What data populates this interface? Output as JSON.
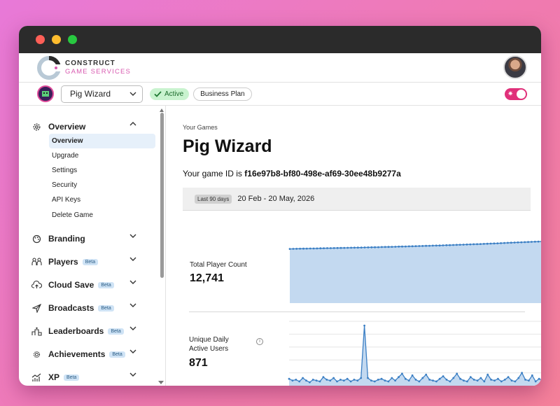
{
  "brand": {
    "name": "CONSTRUCT",
    "subtitle": "GAME SERVICES"
  },
  "toolbar": {
    "game_name": "Pig Wizard",
    "status": "Active",
    "plan": "Business Plan"
  },
  "sidebar": {
    "sections": [
      {
        "label": "Overview",
        "icon": "gear-icon",
        "beta": false,
        "expanded": true
      },
      {
        "label": "Branding",
        "icon": "palette-icon",
        "beta": false
      },
      {
        "label": "Players",
        "icon": "players-icon",
        "beta": true
      },
      {
        "label": "Cloud Save",
        "icon": "cloud-upload-icon",
        "beta": true
      },
      {
        "label": "Broadcasts",
        "icon": "send-icon",
        "beta": true
      },
      {
        "label": "Leaderboards",
        "icon": "podium-icon",
        "beta": true
      },
      {
        "label": "Achievements",
        "icon": "medal-icon",
        "beta": true
      },
      {
        "label": "XP",
        "icon": "chart-up-icon",
        "beta": true
      }
    ],
    "beta_label": "Beta",
    "overview_items": [
      "Overview",
      "Upgrade",
      "Settings",
      "Security",
      "API Keys",
      "Delete Game"
    ],
    "active_item": "Overview"
  },
  "main": {
    "breadcrumb": "Your Games",
    "title": "Pig Wizard",
    "game_id_prefix": "Your game ID is",
    "game_id": "f16e97b8-bf80-498e-af69-30ee48b9277a",
    "range_chip": "Last 90 days",
    "range_text": "20 Feb - 20 May, 2026",
    "stats": {
      "total_label": "Total Player Count",
      "total_value": "12,741",
      "dau_label_1": "Unique Daily",
      "dau_label_2": "Active Users",
      "dau_value": "871"
    }
  },
  "colors": {
    "accent": "#e0307a",
    "chart_line": "#3b7fc4",
    "chart_fill": "#c3d9f0",
    "active_badge_bg": "#c9f3cf"
  },
  "chart_data": [
    {
      "type": "area",
      "series": [
        {
          "values": [
            11200,
            11215,
            11230,
            11250,
            11260,
            11275,
            11290,
            11300,
            11310,
            11330,
            11345,
            11360,
            11370,
            11385,
            11400,
            11410,
            11425,
            11440,
            11455,
            11465,
            11480,
            11500,
            11515,
            11530,
            11545,
            11560,
            11575,
            11590,
            11605,
            11620,
            11640,
            11660,
            11680,
            11700,
            11720,
            11740,
            11760,
            11780,
            11800,
            11820,
            11840,
            11860,
            11880,
            11900,
            11920,
            11945,
            11970,
            11995,
            12020,
            12045,
            12070,
            12095,
            12120,
            12145,
            12170,
            12195,
            12220,
            12250,
            12280,
            12310,
            12340,
            12370,
            12400,
            12430,
            12460,
            12490,
            12520,
            12550,
            12580,
            12610,
            12640,
            12670,
            12700,
            12720,
            12741
          ]
        }
      ],
      "ylim": [
        0,
        12741
      ]
    },
    {
      "type": "area",
      "series": [
        {
          "values": [
            8,
            6,
            7,
            5,
            9,
            6,
            4,
            7,
            6,
            5,
            10,
            7,
            6,
            9,
            5,
            7,
            6,
            8,
            5,
            7,
            6,
            9,
            70,
            9,
            6,
            5,
            7,
            8,
            6,
            5,
            9,
            6,
            10,
            14,
            8,
            6,
            12,
            7,
            5,
            9,
            13,
            7,
            6,
            5,
            8,
            11,
            7,
            5,
            9,
            14,
            8,
            6,
            5,
            10,
            7,
            6,
            9,
            5,
            13,
            7,
            6,
            8,
            5,
            7,
            10,
            6,
            5,
            9,
            15,
            7,
            6,
            12,
            5,
            8,
            6
          ]
        }
      ],
      "ylim": [
        0,
        75
      ]
    }
  ]
}
